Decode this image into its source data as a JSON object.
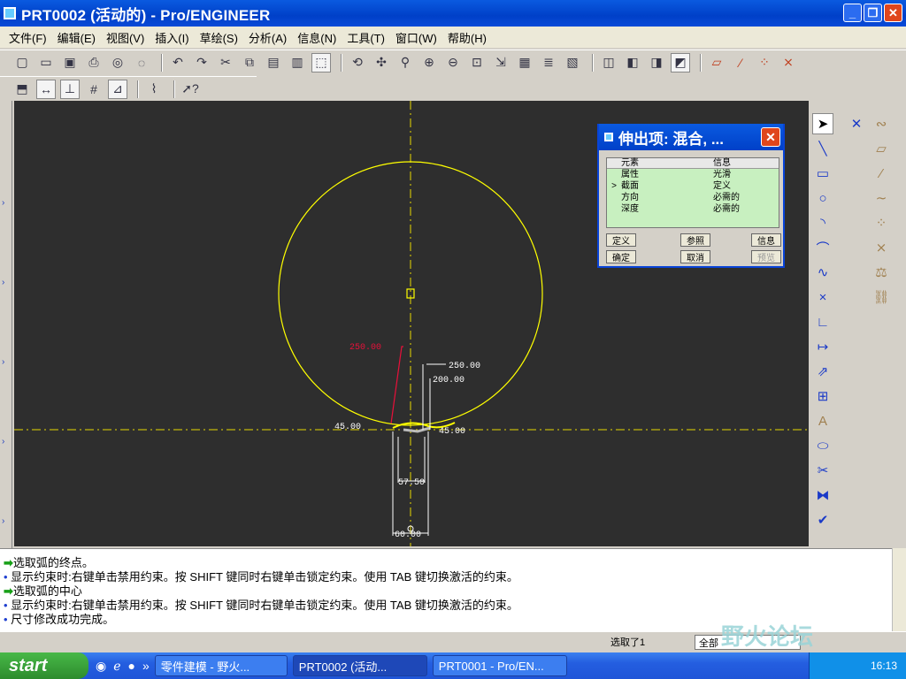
{
  "window": {
    "title": "PRT0002 (活动的) - Pro/ENGINEER"
  },
  "menu": [
    "文件(F)",
    "编辑(E)",
    "视图(V)",
    "插入(I)",
    "草绘(S)",
    "分析(A)",
    "信息(N)",
    "工具(T)",
    "窗口(W)",
    "帮助(H)"
  ],
  "toolbar1_icons": [
    "new-icon",
    "open-icon",
    "save-icon",
    "print-icon",
    "send-icon",
    "email-icon",
    "undo-icon",
    "redo-icon",
    "cut-icon",
    "copy-icon",
    "paste-icon",
    "paste-special-icon",
    "select-box-icon",
    "repaint-icon",
    "spin-center-icon",
    "orient-icon",
    "zoom-in-icon",
    "zoom-out-icon",
    "refit-icon",
    "reorient-icon",
    "saved-views-icon",
    "layers-icon",
    "view-manager-icon",
    "wireframe-icon",
    "hidden-line-icon",
    "no-hidden-icon",
    "shading-icon",
    "datum-planes-icon",
    "datum-axes-icon",
    "datum-points-icon",
    "csys-icon"
  ],
  "toolbar2_icons": [
    "sketch-orient-icon",
    "dimension-display-icon",
    "constraint-display-icon",
    "grid-display-icon",
    "vertex-display-icon",
    "sketch-diagnostics-icon",
    "whats-this-icon"
  ],
  "sketch": {
    "dims": {
      "d_red": "250.00",
      "d_top": "250.00",
      "d_mid": "200.00",
      "d_left": "45.00",
      "d_right": "45.00",
      "d_bottom1": "57.50",
      "d_bottom2": "60.00"
    },
    "colors": {
      "geometry": "#ffff00",
      "centerline": "#e8d800",
      "dimension": "#ffffff",
      "highlight": "#e8103a",
      "background": "#2e2e2e"
    }
  },
  "dialog": {
    "title": "伸出项: 混合, ...",
    "columns": [
      "元素",
      "信息"
    ],
    "rows": [
      {
        "marker": "",
        "element": "属性",
        "info": "光滑"
      },
      {
        "marker": ">",
        "element": "截面",
        "info": "定义"
      },
      {
        "marker": "",
        "element": "方向",
        "info": "必需的"
      },
      {
        "marker": "",
        "element": "深度",
        "info": "必需的"
      }
    ],
    "buttons": {
      "define": "定义",
      "reference": "参照",
      "info": "信息",
      "ok": "确定",
      "cancel": "取消",
      "preview": "预览"
    }
  },
  "messages": [
    {
      "type": "prompt",
      "text": "选取弧的终点。"
    },
    {
      "type": "info",
      "text": "显示约束时:右键单击禁用约束。按 SHIFT 键同时右键单击锁定约束。使用 TAB 键切换激活的约束。"
    },
    {
      "type": "prompt",
      "text": "选取弧的中心"
    },
    {
      "type": "info",
      "text": "显示约束时:右键单击禁用约束。按 SHIFT 键同时右键单击锁定约束。使用 TAB 键切换激活的约束。"
    },
    {
      "type": "info",
      "text": "尺寸修改成功完成。"
    }
  ],
  "status": {
    "selected": "选取了1",
    "filter": "全部"
  },
  "watermark": "野火论坛",
  "taskbar": {
    "start": "start",
    "tasks": [
      "零件建模 - 野火...",
      "PRT0002 (活动...",
      "PRT0001 - Pro/EN..."
    ],
    "clock": "16:13"
  }
}
